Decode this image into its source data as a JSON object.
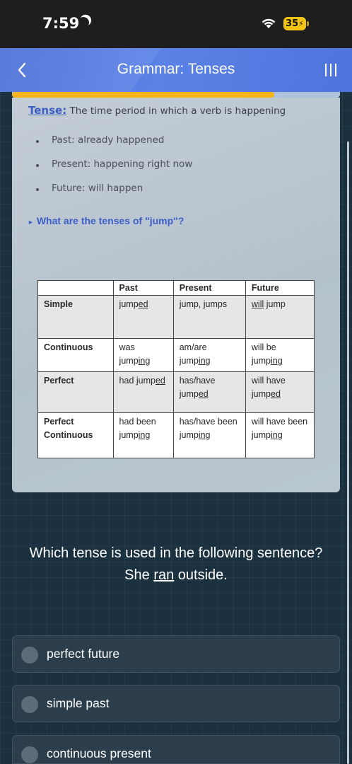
{
  "status_bar": {
    "time": "7:59",
    "battery": "35",
    "icons": [
      "moon-icon",
      "wifi-icon",
      "battery-icon"
    ]
  },
  "header": {
    "title": "Grammar: Tenses",
    "back_icon": "chevron-left-icon",
    "menu_icon": "hamburger-menu-icon",
    "accent_color": "#5b82e6"
  },
  "progress": {
    "fraction": 0.8,
    "fill_color": "#f3b51b"
  },
  "lesson": {
    "definition_term": "Tense:",
    "definition_text": " The time period in which a verb is happening",
    "bullets": [
      "Past: already happened",
      "Present: happening right now",
      "Future: will happen"
    ],
    "question_link": "What are the tenses of \"jump\"?",
    "table": {
      "headers": [
        "",
        "Past",
        "Present",
        "Future"
      ],
      "rows": [
        {
          "label": "Simple",
          "past": [
            "jump",
            "ed"
          ],
          "present": "jump, jumps",
          "future": [
            "will",
            " jump"
          ]
        },
        {
          "label": "Continuous",
          "past": [
            "was jump",
            "ing"
          ],
          "present": [
            "am/are jump",
            "ing"
          ],
          "future": [
            "will be jump",
            "ing"
          ]
        },
        {
          "label": "Perfect",
          "past": [
            "had jump",
            "ed"
          ],
          "present": [
            "has/have jump",
            "ed"
          ],
          "future": [
            "will have jump",
            "ed"
          ]
        },
        {
          "label": "Perfect Continuous",
          "past": [
            "had been jump",
            "ing"
          ],
          "present": [
            "has/have been jump",
            "ing"
          ],
          "future": [
            "will have been jump",
            "ing"
          ]
        }
      ]
    }
  },
  "question": {
    "line1": "Which tense is used in the following sentence?",
    "line2_pre": "She ",
    "line2_word": "ran",
    "line2_post": " outside."
  },
  "options": [
    {
      "label": "perfect future"
    },
    {
      "label": "simple past"
    },
    {
      "label": "continuous present"
    }
  ]
}
